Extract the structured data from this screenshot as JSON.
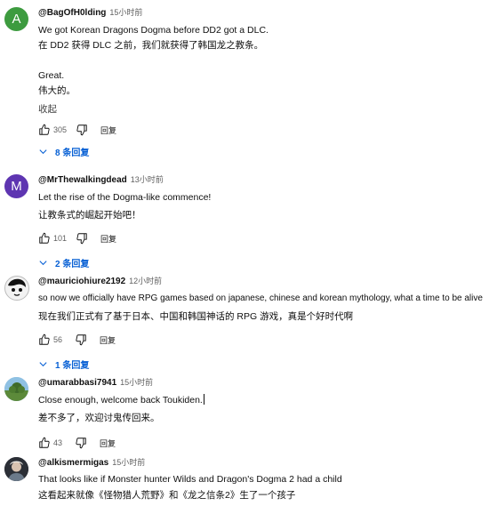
{
  "colors": {
    "accent": "#065fd4",
    "avatar_a": "#3d9b3f",
    "avatar_m": "#5e35b1"
  },
  "comments": [
    {
      "avatar_letter": "A",
      "author": "@BagOfH0lding",
      "time": "15小时前",
      "lines": [
        "We got Korean Dragons Dogma before DD2 got a DLC.",
        "在 DD2 获得 DLC 之前，我们就获得了韩国龙之教条。",
        "",
        "Great.",
        "伟大的。"
      ],
      "fold_label": "收起",
      "likes": "305",
      "reply_label": "回复",
      "replies_label": "8 条回复"
    },
    {
      "avatar_letter": "M",
      "author": "@MrThewalkingdead",
      "time": "13小时前",
      "lines": [
        "Let the rise of the Dogma-like commence!",
        "让教条式的崛起开始吧！"
      ],
      "likes": "101",
      "reply_label": "回复",
      "replies_label": "2 条回复"
    },
    {
      "author": "@mauriciohiure2192",
      "time": "12小时前",
      "lines": [
        "so now we officially have RPG games based on japanese, chinese and korean mythology, what a time to be alive",
        "现在我们正式有了基于日本、中国和韩国神话的 RPG 游戏，真是个好时代啊"
      ],
      "likes": "56",
      "reply_label": "回复",
      "replies_label": "1 条回复"
    },
    {
      "author": "@umarabbasi7941",
      "time": "15小时前",
      "lines": [
        "Close enough, welcome back Toukiden.",
        "差不多了，欢迎讨鬼传回来。"
      ],
      "likes": "43",
      "reply_label": "回复"
    },
    {
      "author": "@alkismermigas",
      "time": "15小时前",
      "lines": [
        "That looks like if Monster hunter Wilds and Dragon's Dogma 2 had a child",
        "这看起来就像《怪物猎人荒野》和《龙之信条2》生了一个孩子"
      ]
    }
  ]
}
